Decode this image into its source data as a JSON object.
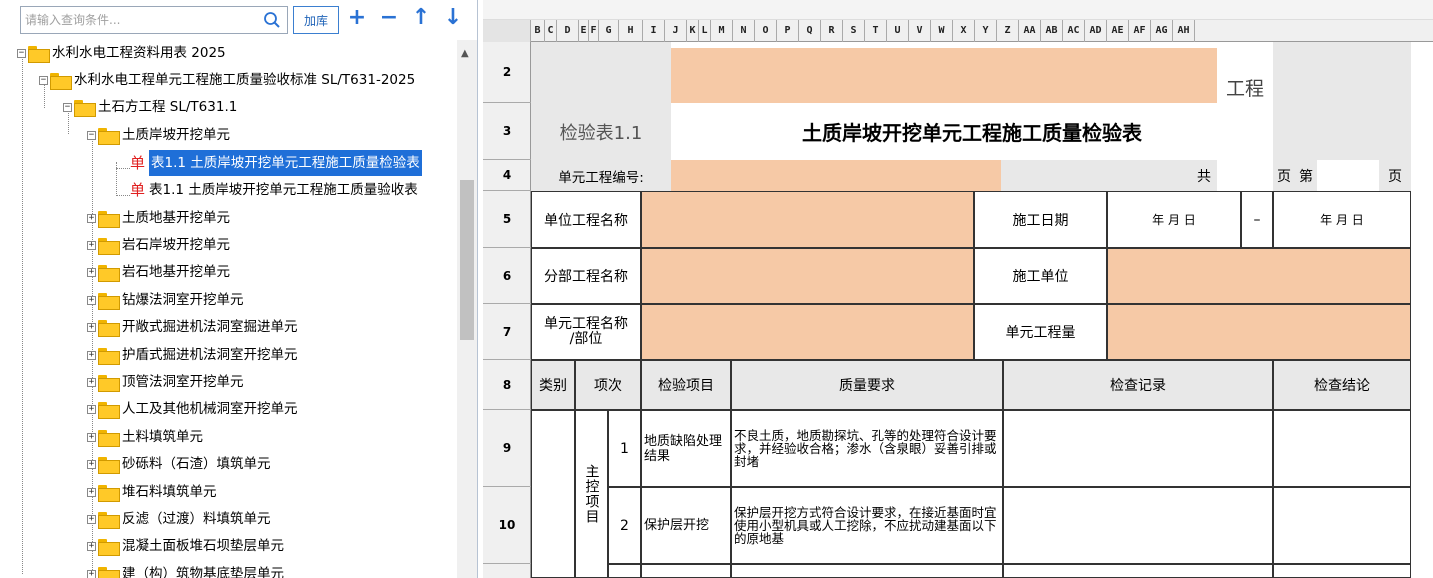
{
  "search": {
    "placeholder": "请输入查询条件...",
    "add_lib_label": "加库"
  },
  "tree": [
    {
      "label": "水利水电工程资料用表 2025",
      "level": 0
    },
    {
      "label": "水利水电工程单元工程施工质量验收标准 SL/T631-2025",
      "level": 1
    },
    {
      "label": "土石方工程 SL/T631.1",
      "level": 2
    },
    {
      "label": "土质岸坡开挖单元",
      "level": 3
    },
    {
      "label": "表1.1 土质岸坡开挖单元工程施工质量检验表",
      "level": 4,
      "prefix": "单",
      "selected": true
    },
    {
      "label": "表1.1 土质岸坡开挖单元工程施工质量验收表",
      "level": 4,
      "prefix": "单"
    },
    {
      "label": "土质地基开挖单元",
      "level": 3
    },
    {
      "label": "岩石岸坡开挖单元",
      "level": 3
    },
    {
      "label": "岩石地基开挖单元",
      "level": 3
    },
    {
      "label": "钻爆法洞室开挖单元",
      "level": 3
    },
    {
      "label": "开敞式掘进机法洞室掘进单元",
      "level": 3
    },
    {
      "label": "护盾式掘进机法洞室开挖单元",
      "level": 3
    },
    {
      "label": "顶管法洞室开挖单元",
      "level": 3
    },
    {
      "label": "人工及其他机械洞室开挖单元",
      "level": 3
    },
    {
      "label": "土料填筑单元",
      "level": 3
    },
    {
      "label": "砂砾料（石渣）填筑单元",
      "level": 3
    },
    {
      "label": "堆石料填筑单元",
      "level": 3
    },
    {
      "label": "反滤（过渡）料填筑单元",
      "level": 3
    },
    {
      "label": "混凝土面板堆石坝垫层单元",
      "level": 3
    },
    {
      "label": "建（构）筑物基底垫层单元",
      "level": 3
    }
  ],
  "columns": [
    "B",
    "C",
    "D",
    "E",
    "F",
    "G",
    "H",
    "I",
    "J",
    "K",
    "L",
    "M",
    "N",
    "O",
    "P",
    "Q",
    "R",
    "S",
    "T",
    "U",
    "V",
    "W",
    "X",
    "Y",
    "Z",
    "AA",
    "AB",
    "AC",
    "AD",
    "AE",
    "AF",
    "AG",
    "AH"
  ],
  "rows": [
    "2",
    "3",
    "4",
    "5",
    "6",
    "7",
    "8",
    "9",
    "10"
  ],
  "sheet": {
    "project_suffix": "工程",
    "form_no": "检验表1.1",
    "form_title": "土质岸坡开挖单元工程施工质量检验表",
    "unit_no_label": "单元工程编号:",
    "total_label": "共",
    "page_label": "页",
    "nth_label": "第",
    "page_label2": "页",
    "unit_project_name": "单位工程名称",
    "construction_date": "施工日期",
    "date_from": "年  月  日",
    "dash": "–",
    "date_to": "年  月  日",
    "sub_project_name": "分部工程名称",
    "construction_unit": "施工单位",
    "unit_name": "单元工程名称\n/部位",
    "unit_quantity": "单元工程量",
    "h_category": "类别",
    "h_item_no": "项次",
    "h_item": "检验项目",
    "h_req": "质量要求",
    "h_record": "检查记录",
    "h_result": "检查结论",
    "main_items": "主控项目",
    "r1_no": "1",
    "r1_item": "地质缺陷处理结果",
    "r1_req": "不良土质，地质勘探坑、孔等的处理符合设计要求，并经验收合格；渗水（含泉眼）妥善引排或封堵",
    "r2_no": "2",
    "r2_item": "保护层开挖",
    "r2_req": "保护层开挖方式符合设计要求，在接近基面时宜使用小型机具或人工挖除，不应扰动建基面以下的原地基"
  }
}
